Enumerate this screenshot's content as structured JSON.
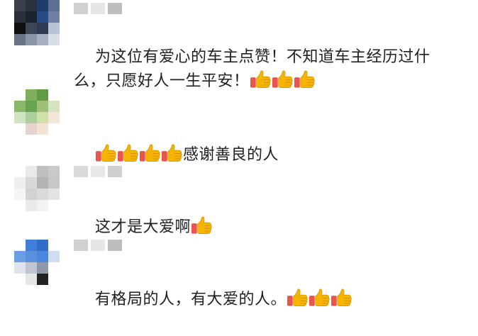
{
  "comments": [
    {
      "text_before": "为这位有爱心的车主点赞！不知道车主经历过什么，只愿好人一生平安！",
      "thumbs_before": 0,
      "text_after": "",
      "thumbs_after": 3,
      "avatar_colors": [
        "#3a3f4a",
        "#2a3140",
        "#1f3b6b",
        "#5a6f93",
        "#2b2f3a",
        "#1c2230",
        "#274a85",
        "#6d7fa3",
        "#0f0f12",
        "#3d4657",
        "#2f3b52",
        "#b9c3d6",
        "#6a7386",
        "#8b95a8",
        "#a6b0c2",
        "#d7dce6"
      ],
      "name_blur_colors": [
        "#d0d0d0",
        "#e6e6e6",
        "#bdbdbd"
      ]
    },
    {
      "text_before": "",
      "thumbs_before": 4,
      "text_after": "感谢善良的人",
      "thumbs_after": 0,
      "avatar_colors": [
        "#ffffff",
        "#7fae5c",
        "#5f9a45",
        "#ffffff",
        "#88b868",
        "#6aa34f",
        "#9ec07a",
        "#d5e3c1",
        "#cfe2c4",
        "#a9d09a",
        "#cfe0a9",
        "#f2e6d9",
        "#ffffff",
        "#e6d3cf",
        "#f4e3d4",
        "#ffffff"
      ],
      "name_blur_colors": []
    },
    {
      "text_before": "这才是大爱啊",
      "thumbs_before": 0,
      "text_after": "",
      "thumbs_after": 1,
      "avatar_colors": [
        "#ffffff",
        "#e9e9e9",
        "#bfbfbf",
        "#c9c9c9",
        "#eeeeee",
        "#d8d8d8",
        "#b3b3b3",
        "#c7c7c7",
        "#f5f5f5",
        "#d2d2d2",
        "#dadada",
        "#e3e3e3",
        "#ffffff",
        "#eaeaea",
        "#f2f2f2",
        "#ffffff"
      ],
      "name_blur_colors": [
        "#d9d9d9",
        "#e8e8e8",
        "#cfcfcf"
      ]
    },
    {
      "text_before": "有格局的人，有大爱的人。",
      "thumbs_before": 0,
      "text_after": "",
      "thumbs_after": 3,
      "avatar_colors": [
        "#ffffff",
        "#3f7fd8",
        "#2f6ec9",
        "#ffffff",
        "#6a9ee3",
        "#5a8fe0",
        "#4b87df",
        "#cfdcf1",
        "#dfe3ea",
        "#bfc6d2",
        "#8e98a8",
        "#ffffff",
        "#ffffff",
        "#e6e6e6",
        "#222222",
        "#ffffff"
      ],
      "name_blur_colors": [
        "#d0d0d0",
        "#e6e6e6",
        "#bdbdbd"
      ]
    }
  ],
  "colors": {
    "text": "#1f1f1f",
    "background": "#ffffff",
    "thumb_fill": "#f5b400",
    "thumb_cuff": "#e8554e"
  }
}
